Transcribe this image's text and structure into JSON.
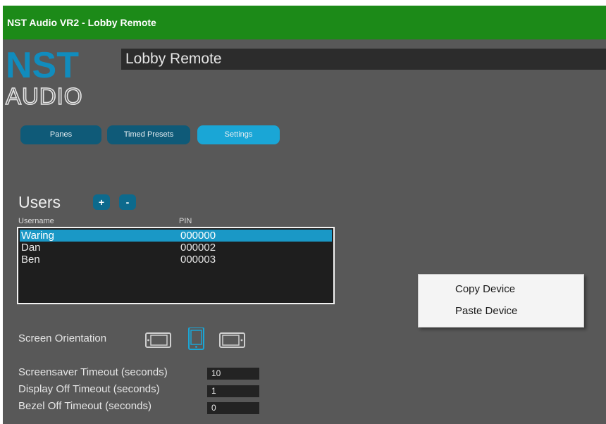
{
  "window": {
    "title": "NST Audio VR2 - Lobby Remote"
  },
  "logo": {
    "line1": "NST",
    "line2": "AUDIO"
  },
  "device_name": "Lobby Remote",
  "tabs": [
    {
      "label": "Panes",
      "active": false
    },
    {
      "label": "Timed Presets",
      "active": false
    },
    {
      "label": "Settings",
      "active": true
    }
  ],
  "users": {
    "title": "Users",
    "add_label": "+",
    "remove_label": "-",
    "columns": {
      "username": "Username",
      "pin": "PIN"
    },
    "rows": [
      {
        "username": "Waring",
        "pin": "000000",
        "selected": true
      },
      {
        "username": "Dan",
        "pin": "000002",
        "selected": false
      },
      {
        "username": "Ben",
        "pin": "000003",
        "selected": false
      }
    ]
  },
  "context_menu": {
    "items": [
      "Copy Device",
      "Paste Device"
    ]
  },
  "screen_orientation": {
    "label": "Screen Orientation",
    "options": [
      "landscape-left-icon",
      "portrait-icon",
      "landscape-right-icon"
    ],
    "selected": "portrait-icon"
  },
  "timeouts": [
    {
      "label": "Screensaver Timeout (seconds)",
      "value": "10"
    },
    {
      "label": "Display Off Timeout (seconds)",
      "value": "1"
    },
    {
      "label": "Bezel Off Timeout (seconds)",
      "value": "0"
    }
  ],
  "colors": {
    "titlebar": "#1c8a18",
    "panel": "#585858",
    "accent": "#1aa6d6",
    "tab_dark": "#0f5a78"
  }
}
